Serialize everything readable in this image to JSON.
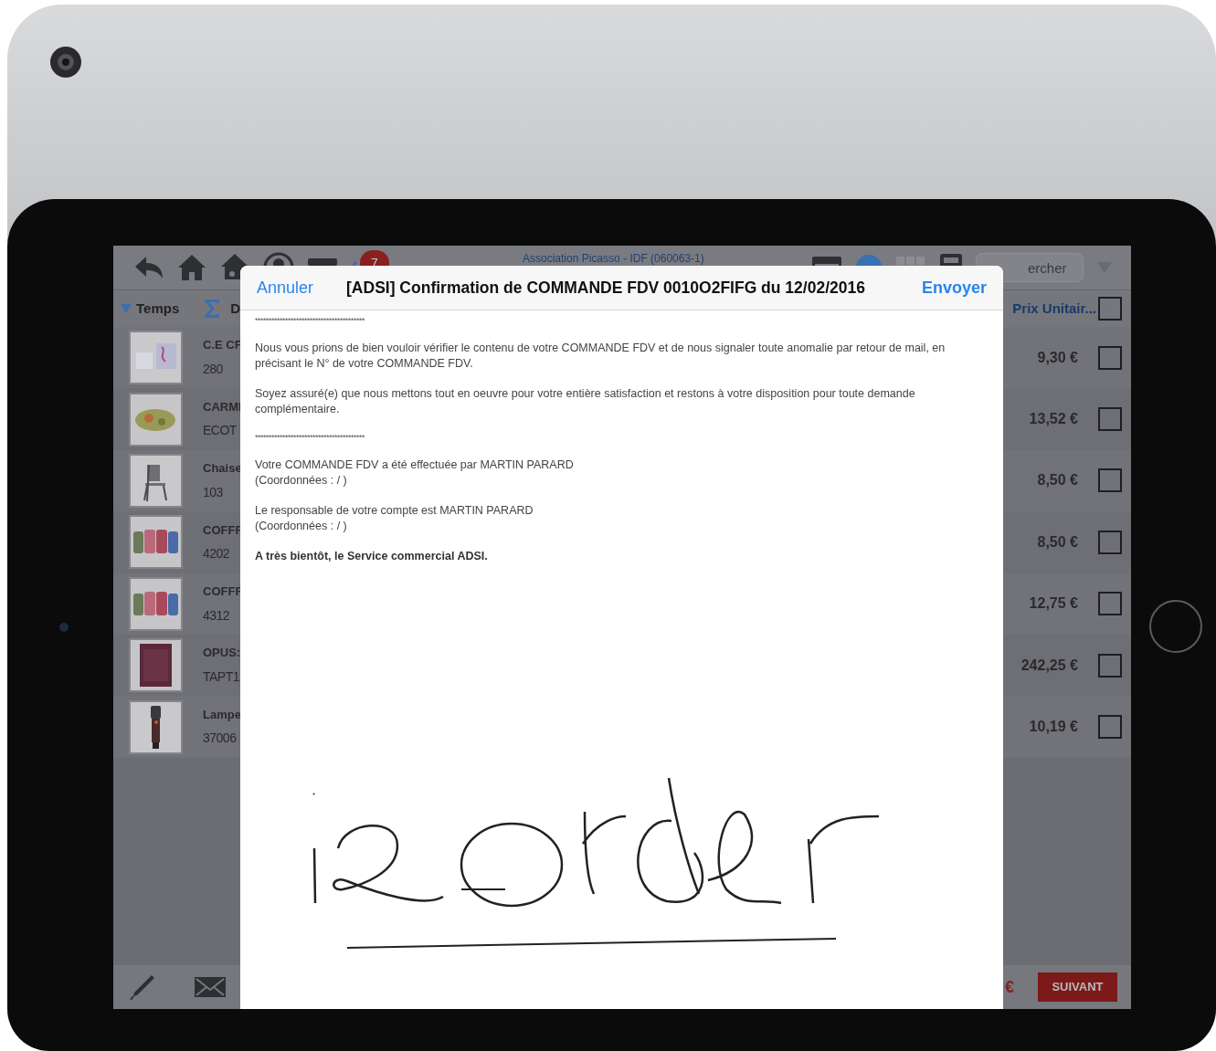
{
  "toolbar": {
    "badge": "7",
    "title": "Association Picasso - IDF (060063-1)",
    "search": {
      "placeholder": "ercher"
    }
  },
  "columns": {
    "sort": "Temps",
    "column_2": "D",
    "price": "Prix Unitair...",
    "select_all": {
      "checked": false
    }
  },
  "rows": [
    {
      "name": "C.E CF",
      "code": "280",
      "price": "9,30 €",
      "checked": false
    },
    {
      "name": "CARMI",
      "code": "ECOT",
      "price": "13,52 €",
      "checked": false
    },
    {
      "name": "Chaise",
      "code": "103",
      "price": "8,50 €",
      "checked": false
    },
    {
      "name": "COFFF",
      "code": "4202",
      "price": "8,50 €",
      "checked": false
    },
    {
      "name": "COFFF",
      "code": "4312",
      "price": "12,75 €",
      "checked": false
    },
    {
      "name": "OPUS:",
      "code": "TAPT1",
      "price": "242,25 €",
      "checked": false
    },
    {
      "name": "Lampe",
      "code": "37006",
      "price": "10,19 €",
      "checked": false
    }
  ],
  "bottom_bar": {
    "total": "€",
    "next_button": "SUIVANT"
  },
  "modal": {
    "cancel": "Annuler",
    "title": "[ADSI] Confirmation de COMMANDE FDV 0010O2FIFG du 12/02/2016",
    "send": "Envoyer",
    "body": [
      {
        "kind": "separator",
        "text": "****************************************"
      },
      {
        "kind": "paragraph",
        "lines": [
          "Nous vous prions de bien vouloir vérifier le contenu de votre COMMANDE FDV et de nous signaler toute anomalie par retour de mail, en précisant le N° de votre COMMANDE FDV."
        ]
      },
      {
        "kind": "paragraph",
        "lines": [
          "Soyez assuré(e) que nous mettons tout en oeuvre pour votre entière satisfaction et restons à votre disposition pour toute demande complémentaire."
        ]
      },
      {
        "kind": "separator",
        "text": "****************************************"
      },
      {
        "kind": "paragraph",
        "lines": [
          "Votre COMMANDE FDV a été effectuée par MARTIN PARARD",
          "(Coordonnées : / )"
        ]
      },
      {
        "kind": "paragraph",
        "lines": [
          "Le responsable de votre compte est MARTIN PARARD",
          "(Coordonnées : / )"
        ]
      },
      {
        "kind": "bold",
        "lines": [
          "A très bientôt, le Service commercial ADSI."
        ]
      }
    ]
  }
}
